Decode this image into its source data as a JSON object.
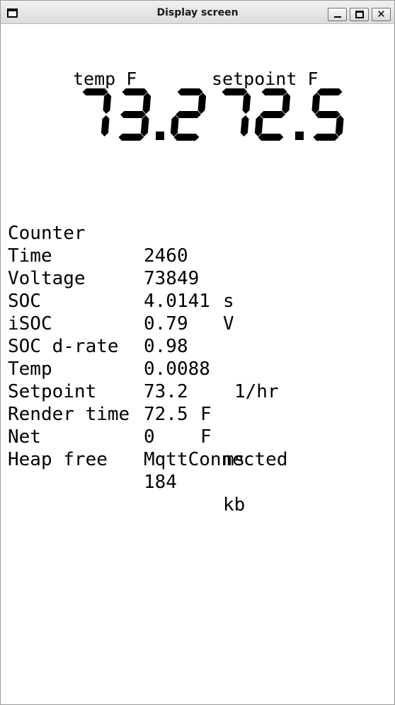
{
  "window": {
    "title": "Display screen"
  },
  "big_display": {
    "temp_label": "temp F",
    "temp_value": "73.2",
    "setpoint_label": "setpoint F",
    "setpoint_value": "72.5"
  },
  "rows": [
    {
      "key": "Counter",
      "value": "2460",
      "unit": ""
    },
    {
      "key": "Time",
      "value": "73849",
      "unit": "s"
    },
    {
      "key": "Voltage",
      "value": "4.0141",
      "unit": "V"
    },
    {
      "key": "SOC",
      "value": "0.79",
      "unit": ""
    },
    {
      "key": "iSOC",
      "value": "0.98",
      "unit": ""
    },
    {
      "key": "SOC d-rate",
      "value": "0.0088",
      "unit": "1/hr"
    },
    {
      "key": "Temp",
      "value": "73.2",
      "unit": "F"
    },
    {
      "key": "Setpoint",
      "value": "72.5",
      "unit": "F"
    },
    {
      "key": "Render time",
      "value": "0",
      "unit": "ms"
    },
    {
      "key": "Net",
      "value": "MqttConnected",
      "unit": ""
    },
    {
      "key": "Heap free",
      "value": "184",
      "unit": "kb"
    }
  ]
}
